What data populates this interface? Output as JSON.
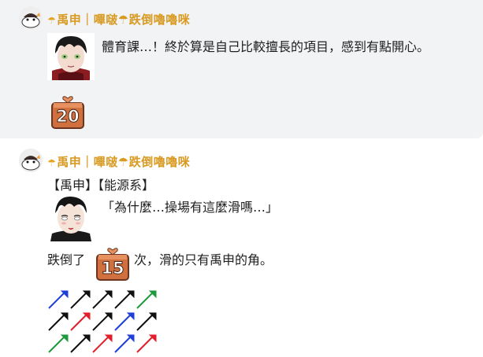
{
  "messages": [
    {
      "username": "禹申｜嗶啵☂跌倒嚕嚕咪",
      "text": "體育課…！終於算是自己比較擅長的項目，感到有點開心。",
      "dice_value": "20"
    },
    {
      "username": "禹申｜嗶啵☂跌倒嚕嚕咪",
      "tag_line": "【禹申】【能源系】",
      "quote": "「為什麼…操場有這麼滑嗎…」",
      "text_before": "跌倒了",
      "dice_value": "15",
      "text_after": "次，滑的只有禹申的角。"
    }
  ],
  "icons": {
    "umbrella": "☂",
    "dice": "dice-icon",
    "arrow": "arrow-icon"
  },
  "colors": {
    "username": "#d99a22",
    "message_bg": "#f2f3f5",
    "dice_body": "#d0703f",
    "arrow_blue": "#1f3fd8",
    "arrow_red": "#e0202a",
    "arrow_green": "#1e9a3a",
    "arrow_black": "#111111"
  }
}
